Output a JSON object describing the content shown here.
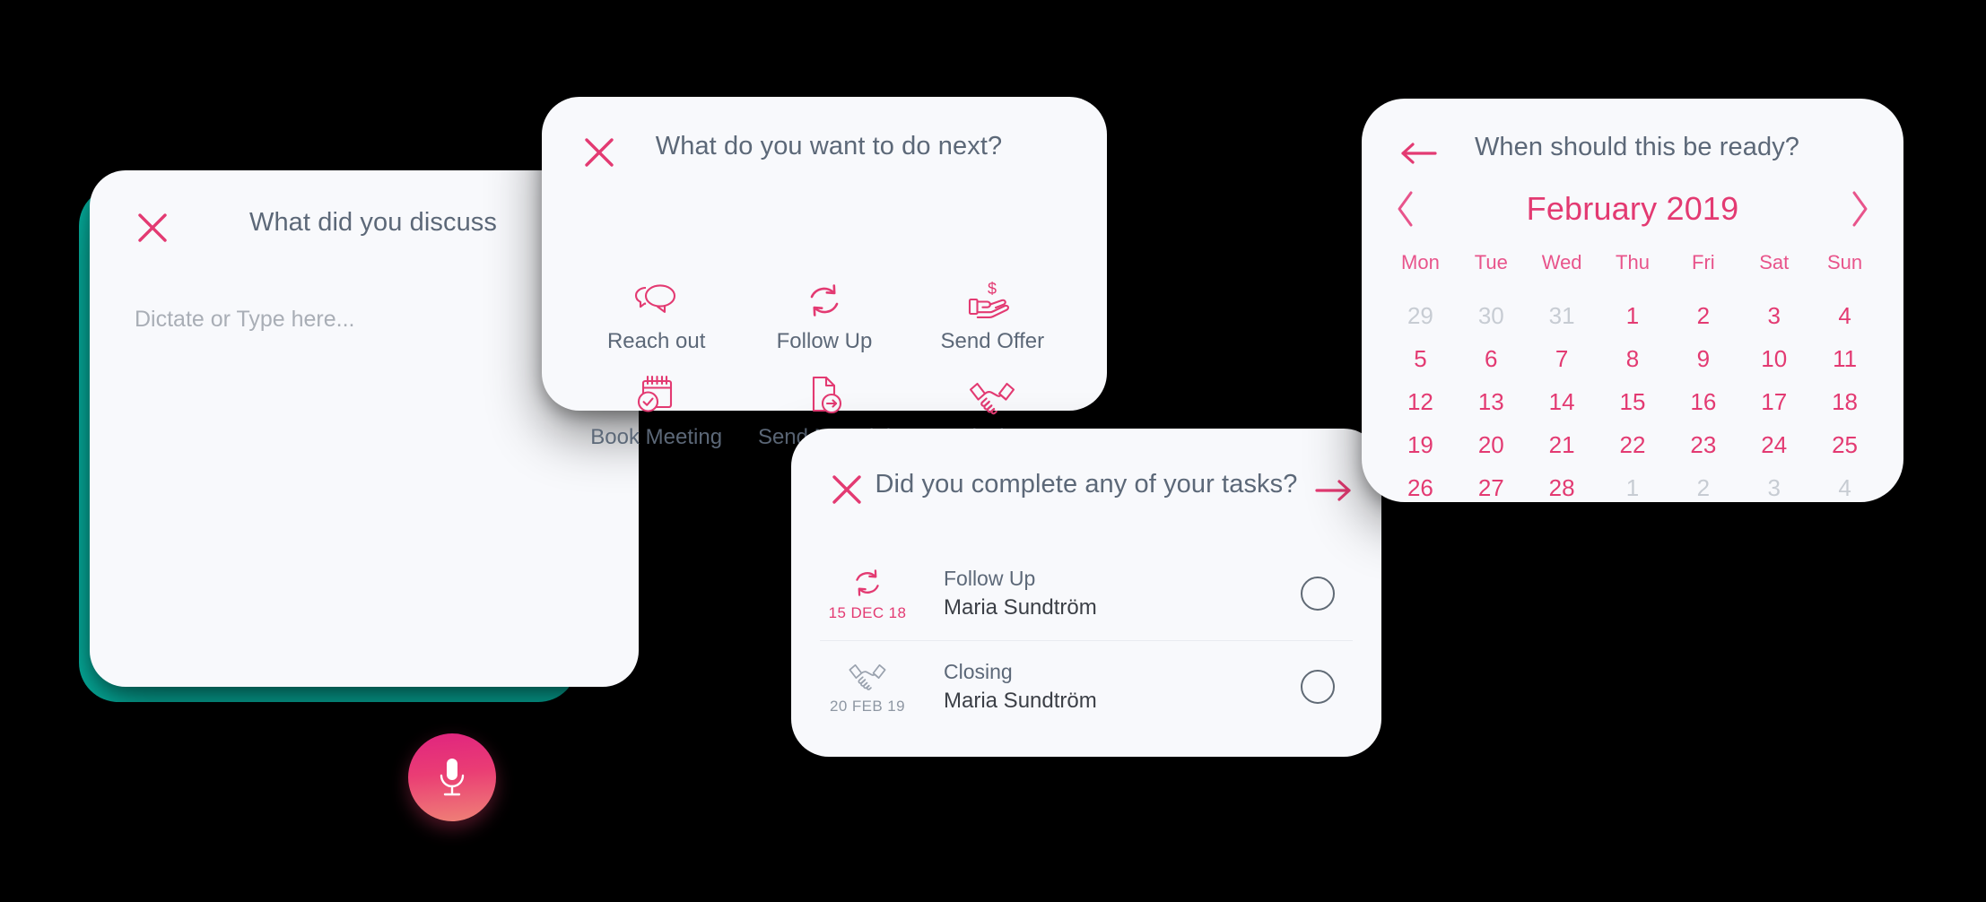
{
  "discuss_card": {
    "close_icon": "close-icon",
    "title": "What did you discuss",
    "placeholder": "Dictate or Type here...",
    "mic_icon": "microphone-icon",
    "accent_color": "#06b6a4"
  },
  "next_card": {
    "close_icon": "close-icon",
    "title": "What do you want to do next?",
    "actions": [
      {
        "label": "Reach out",
        "icon": "speech-bubbles-icon"
      },
      {
        "label": "Follow Up",
        "icon": "refresh-cycle-icon"
      },
      {
        "label": "Send Offer",
        "icon": "hand-money-icon"
      },
      {
        "label": "Book Meeting",
        "icon": "calendar-check-icon"
      },
      {
        "label": "Send Material",
        "icon": "document-send-icon"
      },
      {
        "label": "Closing",
        "icon": "handshake-icon"
      }
    ]
  },
  "tasks_card": {
    "close_icon": "close-icon",
    "title": "Did you complete any of your tasks?",
    "next_icon": "arrow-right-icon",
    "rows": [
      {
        "icon": "refresh-cycle-icon",
        "date": "15 DEC 18",
        "type": "Follow Up",
        "person": "Maria Sundtröm",
        "state": "active",
        "checked": false
      },
      {
        "icon": "handshake-icon",
        "date": "20 FEB 19",
        "type": "Closing",
        "person": "Maria Sundtröm",
        "state": "inactive",
        "checked": false
      }
    ]
  },
  "calendar_card": {
    "back_icon": "arrow-left-icon",
    "title": "When should this be ready?",
    "prev_icon": "chevron-left-icon",
    "next_icon": "chevron-right-icon",
    "month_label": "February 2019",
    "weekdays": [
      "Mon",
      "Tue",
      "Wed",
      "Thu",
      "Fri",
      "Sat",
      "Sun"
    ],
    "days": [
      {
        "n": "29",
        "muted": true
      },
      {
        "n": "30",
        "muted": true
      },
      {
        "n": "31",
        "muted": true
      },
      {
        "n": "1",
        "muted": false
      },
      {
        "n": "2",
        "muted": false
      },
      {
        "n": "3",
        "muted": false
      },
      {
        "n": "4",
        "muted": false
      },
      {
        "n": "5",
        "muted": false
      },
      {
        "n": "6",
        "muted": false
      },
      {
        "n": "7",
        "muted": false
      },
      {
        "n": "8",
        "muted": false
      },
      {
        "n": "9",
        "muted": false
      },
      {
        "n": "10",
        "muted": false
      },
      {
        "n": "11",
        "muted": false
      },
      {
        "n": "12",
        "muted": false
      },
      {
        "n": "13",
        "muted": false
      },
      {
        "n": "14",
        "muted": false
      },
      {
        "n": "15",
        "muted": false
      },
      {
        "n": "16",
        "muted": false
      },
      {
        "n": "17",
        "muted": false
      },
      {
        "n": "18",
        "muted": false
      },
      {
        "n": "19",
        "muted": false
      },
      {
        "n": "20",
        "muted": false
      },
      {
        "n": "21",
        "muted": false
      },
      {
        "n": "22",
        "muted": false
      },
      {
        "n": "23",
        "muted": false
      },
      {
        "n": "24",
        "muted": false
      },
      {
        "n": "25",
        "muted": false
      },
      {
        "n": "26",
        "muted": false
      },
      {
        "n": "27",
        "muted": false
      },
      {
        "n": "28",
        "muted": false
      },
      {
        "n": "1",
        "muted": true
      },
      {
        "n": "2",
        "muted": true
      },
      {
        "n": "3",
        "muted": true
      },
      {
        "n": "4",
        "muted": true
      }
    ]
  },
  "colors": {
    "pink": "#e33a72",
    "pink_light": "#e8548b",
    "teal": "#06b6a4",
    "slate": "#5c6878",
    "muted": "#c7ccd3",
    "card_bg": "#f8f9fc",
    "page_bg": "#000000"
  }
}
